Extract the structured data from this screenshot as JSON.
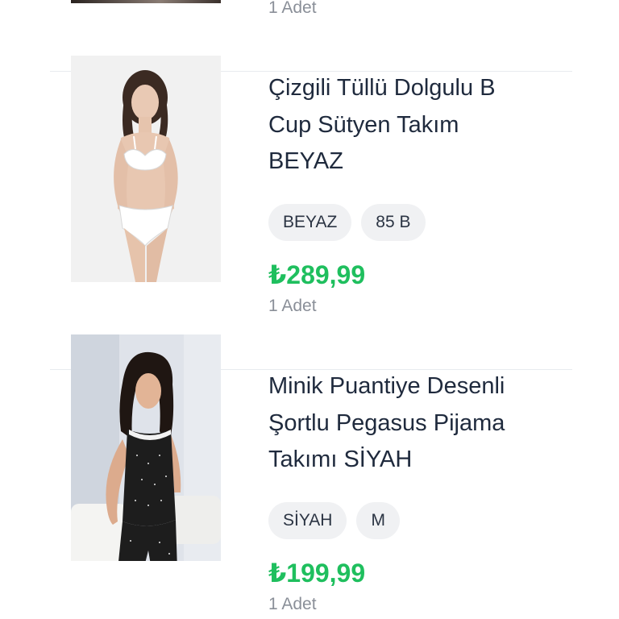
{
  "prev_item": {
    "quantity": "1 Adet"
  },
  "items": [
    {
      "title_lines": [
        "Çizgili Tüllü Dolgulu B",
        "Cup Sütyen Takım",
        "BEYAZ"
      ],
      "chips": [
        "BEYAZ",
        "85 B"
      ],
      "price": "₺289,99",
      "quantity": "1 Adet",
      "image": "model-white-lingerie"
    },
    {
      "title_lines": [
        "Minik Puantiye Desenli",
        "Şortlu Pegasus Pijama",
        "Takımı SİYAH"
      ],
      "chips": [
        "SİYAH",
        "M"
      ],
      "price": "₺199,99",
      "quantity": "1 Adet",
      "image": "model-black-pajama"
    }
  ],
  "colors": {
    "price": "#1fbf5e",
    "chip_bg": "#f0f1f3",
    "title": "#1f2a3d",
    "muted": "#8a8f98"
  }
}
